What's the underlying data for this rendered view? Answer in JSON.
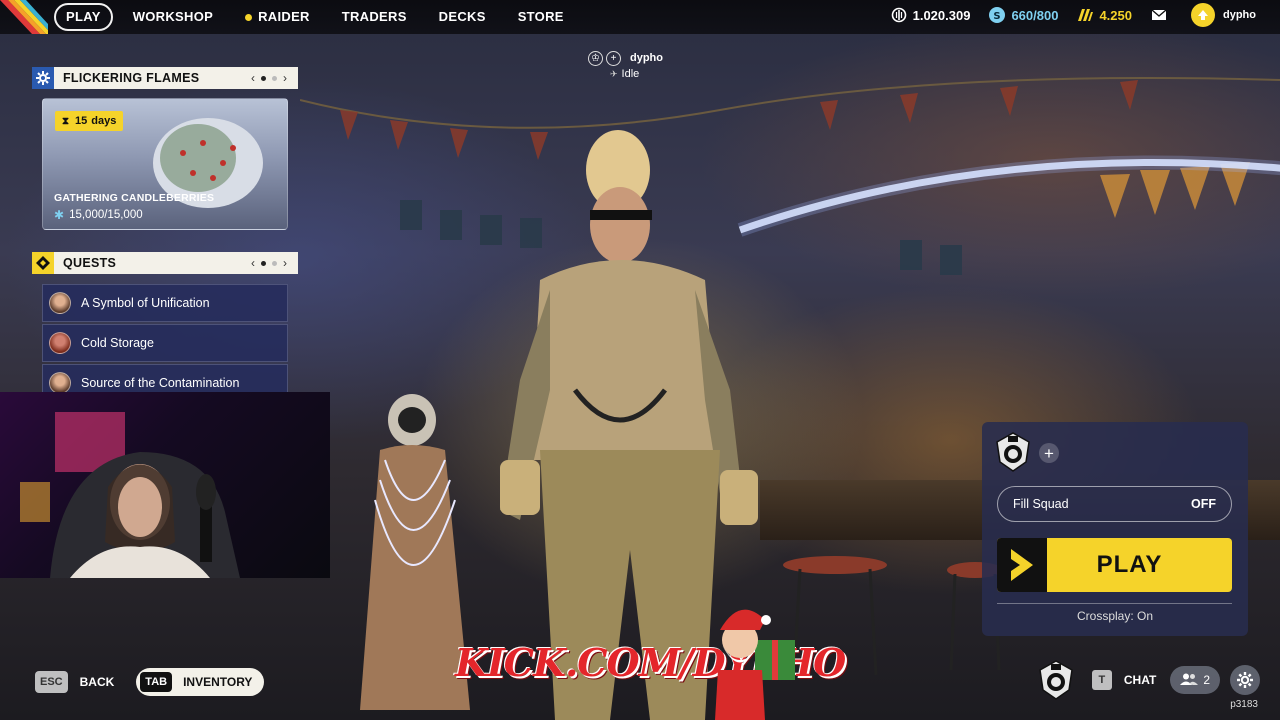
{
  "nav": {
    "items": [
      {
        "label": "PLAY",
        "active": true
      },
      {
        "label": "WORKSHOP"
      },
      {
        "label": "RAIDER"
      },
      {
        "label": "TRADERS"
      },
      {
        "label": "DECKS"
      },
      {
        "label": "STORE"
      }
    ]
  },
  "currencies": {
    "credits": {
      "value": "1.020.309",
      "icon": "credits-icon"
    },
    "coins": {
      "value": "660/800",
      "icon": "coins-icon",
      "color": "#7fd0f0"
    },
    "raider_tokens": {
      "value": "4.250",
      "icon": "raider-token-icon",
      "color": "#f5d32a"
    }
  },
  "profile": {
    "name": "dypho"
  },
  "event": {
    "title": "FLICKERING FLAMES",
    "timer_value": "15",
    "timer_unit": "days",
    "name": "GATHERING CANDLEBERRIES",
    "progress": "15,000/15,000"
  },
  "quests": {
    "title": "QUESTS",
    "items": [
      {
        "label": "A Symbol of Unification"
      },
      {
        "label": "Cold Storage"
      },
      {
        "label": "Source of the Contamination"
      }
    ]
  },
  "player_tag": {
    "name": "dypho",
    "status": "Idle"
  },
  "squad": {
    "fill_label": "Fill Squad",
    "fill_value": "OFF",
    "play_label": "PLAY",
    "crossplay": "Crossplay: On"
  },
  "bottom": {
    "back_key": "ESC",
    "back_label": "BACK",
    "inventory_key": "TAB",
    "inventory_label": "INVENTORY",
    "chat_key": "T",
    "chat_label": "CHAT",
    "friends_count": "2",
    "build": "p3183"
  },
  "overlay": {
    "watermark": "KICK.COM/DYPHO"
  },
  "colors": {
    "accent_yellow": "#f5d32a",
    "panel_blue": "#262c5c",
    "coin_blue": "#7fd0f0"
  }
}
